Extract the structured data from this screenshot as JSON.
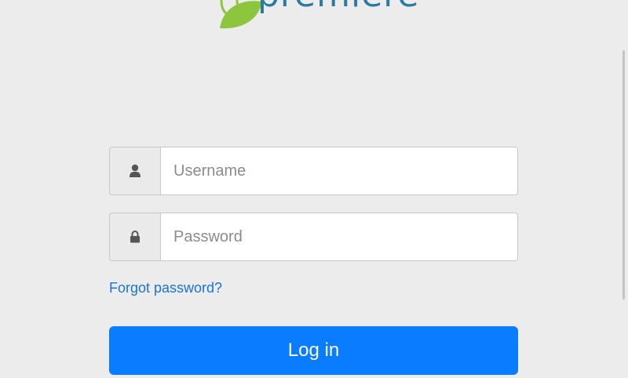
{
  "brand": {
    "logo_text": "premiere",
    "logo_color": "#2c7aa1",
    "leaf_color": "#8cc63f"
  },
  "login": {
    "username": {
      "icon": "user-icon",
      "placeholder": "Username",
      "value": ""
    },
    "password": {
      "icon": "lock-icon",
      "placeholder": "Password",
      "value": ""
    },
    "forgot_label": "Forgot password?",
    "submit_label": "Log in",
    "accent_color": "#0a7cff"
  }
}
